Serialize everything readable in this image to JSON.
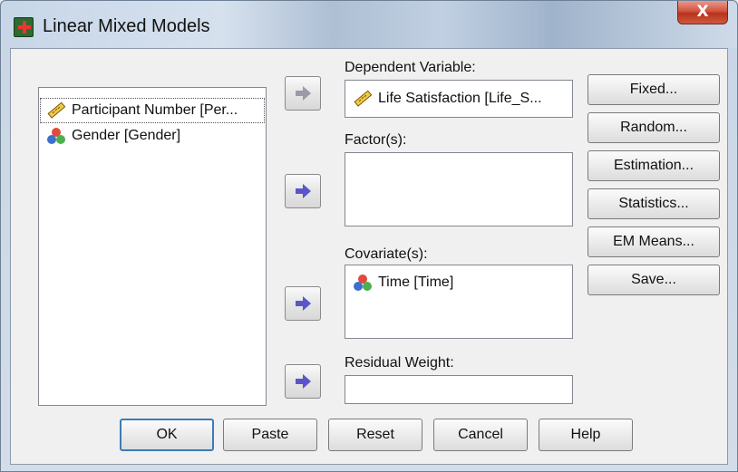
{
  "window": {
    "title": "Linear Mixed Models",
    "close_label": "X"
  },
  "variable_list": [
    {
      "label": "Participant Number [Per...",
      "icon": "ruler-icon"
    },
    {
      "label": "Gender [Gender]",
      "icon": "nominal-icon"
    }
  ],
  "dependent": {
    "label": "Dependent Variable:",
    "value": "Life Satisfaction [Life_S...",
    "icon": "ruler-icon"
  },
  "factors": {
    "label": "Factor(s):"
  },
  "covariates": {
    "label": "Covariate(s):",
    "items": [
      {
        "label": "Time [Time]",
        "icon": "nominal-icon"
      }
    ]
  },
  "residual": {
    "label": "Residual Weight:"
  },
  "side_buttons": [
    "Fixed...",
    "Random...",
    "Estimation...",
    "Statistics...",
    "EM Means...",
    "Save..."
  ],
  "bottom_buttons": [
    "OK",
    "Paste",
    "Reset",
    "Cancel",
    "Help"
  ],
  "colors": {
    "arrow": "#5a55c8",
    "arrow_disabled": "#9a9aaa",
    "default_button_border": "#3d7bb8",
    "close": "#c8412a"
  }
}
